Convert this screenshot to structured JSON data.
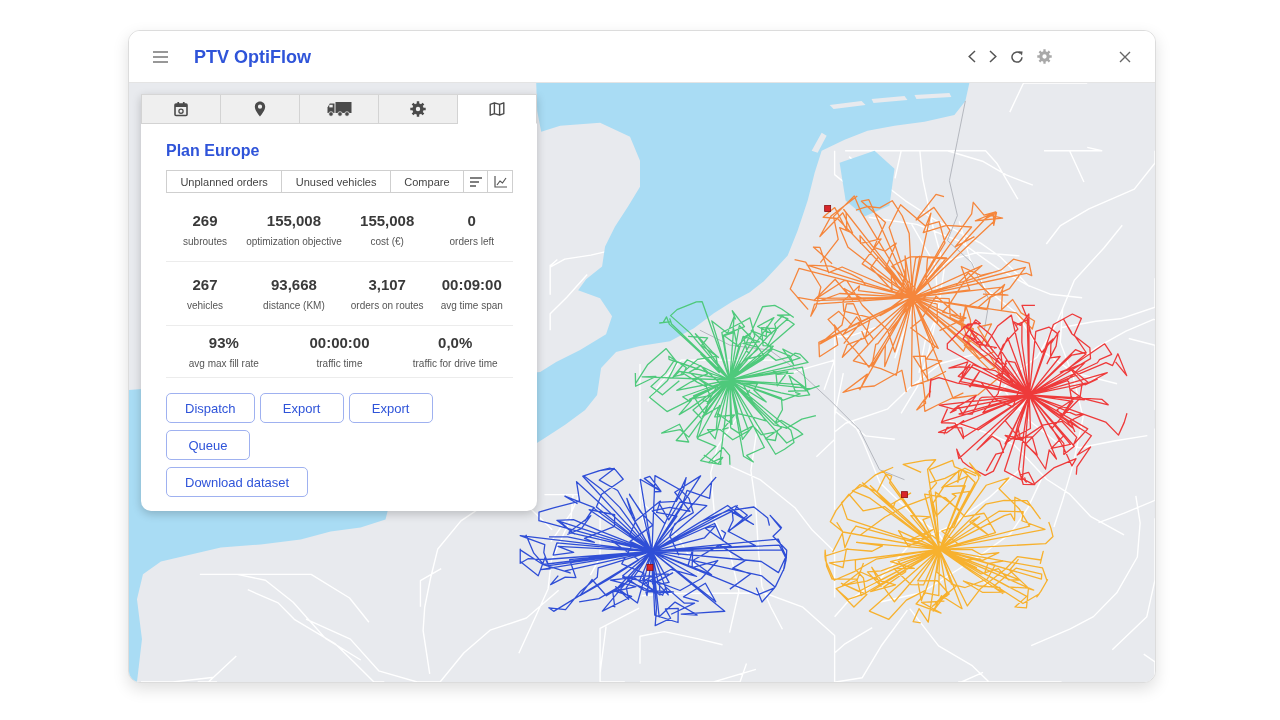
{
  "window": {
    "title": "PTV OptiFlow"
  },
  "tabs": [
    {
      "selected": false
    },
    {
      "selected": false
    },
    {
      "selected": false
    },
    {
      "selected": false
    },
    {
      "selected": true
    }
  ],
  "panel": {
    "title": "Plan Europe",
    "views": [
      "Unplanned orders",
      "Unused vehicles",
      "Compare"
    ],
    "stat_rows": [
      [
        {
          "value": "269",
          "label": "subroutes"
        },
        {
          "value": "155,008",
          "label": "optimization objective"
        },
        {
          "value": "155,008",
          "label": "cost (€)"
        },
        {
          "value": "0",
          "label": "orders left"
        }
      ],
      [
        {
          "value": "267",
          "label": "vehicles"
        },
        {
          "value": "93,668",
          "label": "distance (KM)"
        },
        {
          "value": "3,107",
          "label": "orders on routes"
        },
        {
          "value": "00:09:00",
          "label": "avg time span"
        }
      ],
      [
        {
          "value": "93%",
          "label": "avg max fill rate"
        },
        {
          "value": "00:00:00",
          "label": "traffic time"
        },
        {
          "value": "0,0%",
          "label": "traffic for drive time"
        }
      ]
    ],
    "action_rows": [
      [
        "Dispatch",
        "Export",
        "Export"
      ],
      [
        "Queue"
      ],
      [
        "Download dataset"
      ]
    ]
  },
  "map": {
    "route_clusters": [
      {
        "color": "#f5863c"
      },
      {
        "color": "#4ec97b"
      },
      {
        "color": "#ee3a3a"
      },
      {
        "color": "#f7b12e"
      },
      {
        "color": "#2f4ed6"
      }
    ]
  }
}
